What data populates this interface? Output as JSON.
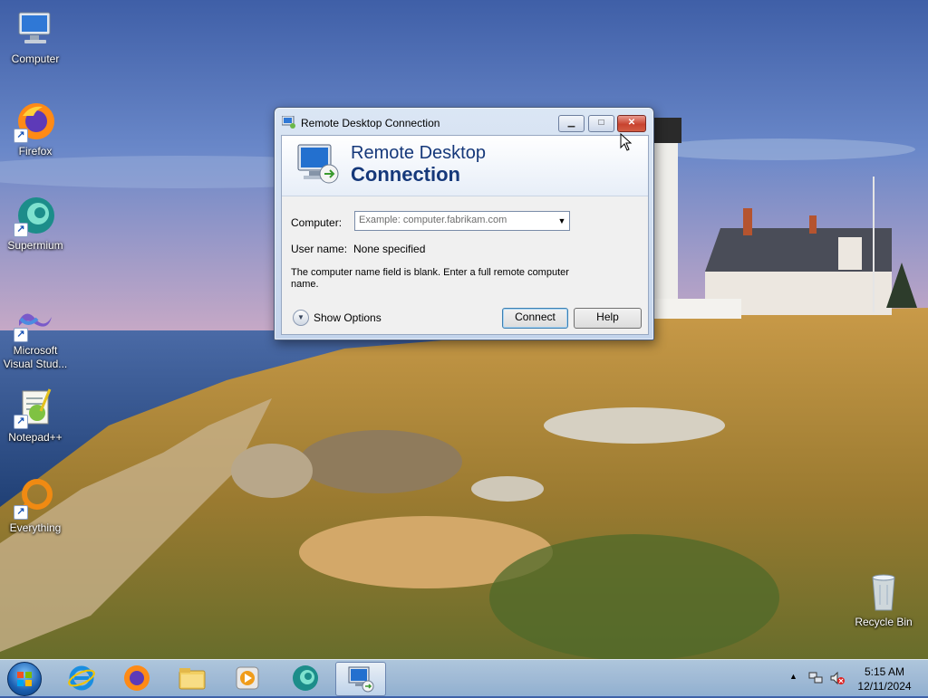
{
  "desktop": {
    "icons": [
      {
        "label": "Computer",
        "icon": "computer-icon"
      },
      {
        "label": "Firefox",
        "icon": "firefox-icon"
      },
      {
        "label": "Supermium",
        "icon": "supermium-icon"
      },
      {
        "label": "Microsoft Visual Stud...",
        "icon": "visual-studio-icon"
      },
      {
        "label": "Notepad++",
        "icon": "notepad-plus-plus-icon"
      },
      {
        "label": "Everything",
        "icon": "everything-search-icon"
      },
      {
        "label": "Recycle Bin",
        "icon": "recycle-bin-icon"
      }
    ]
  },
  "window": {
    "title": "Remote Desktop Connection",
    "banner_line1": "Remote Desktop",
    "banner_line2": "Connection",
    "computer_label": "Computer:",
    "computer_placeholder": "Example: computer.fabrikam.com",
    "computer_value": "",
    "username_label": "User name:",
    "username_value": "None specified",
    "message": "The computer name field is blank. Enter a full remote computer name.",
    "show_options": "Show Options",
    "connect_button": "Connect",
    "help_button": "Help"
  },
  "taskbar": {
    "apps": [
      "internet-explorer-icon",
      "firefox-icon",
      "file-explorer-icon",
      "media-player-icon",
      "supermium-icon",
      "remote-desktop-icon"
    ],
    "active_app": "remote-desktop-icon",
    "clock_time": "5:15 AM",
    "clock_date": "12/11/2024"
  },
  "colors": {
    "sky": "#3f63a8",
    "sea": "#2d4f86",
    "grass": "#b88d3a",
    "banner_text": "#15387a",
    "close_button": "#c8432f"
  }
}
